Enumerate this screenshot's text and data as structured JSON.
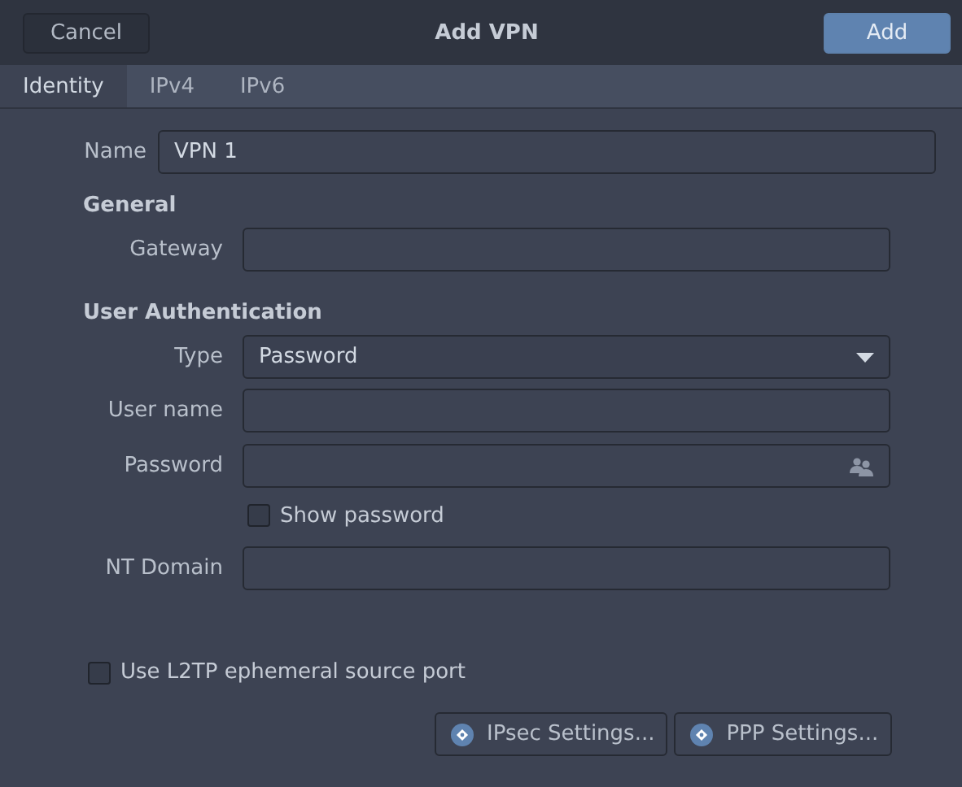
{
  "header": {
    "title": "Add VPN",
    "cancel": "Cancel",
    "add": "Add"
  },
  "tabs": [
    {
      "label": "Identity",
      "selected": true
    },
    {
      "label": "IPv4",
      "selected": false
    },
    {
      "label": "IPv6",
      "selected": false
    }
  ],
  "name": {
    "label": "Name",
    "value": "VPN 1"
  },
  "general": {
    "heading": "General",
    "gateway": {
      "label": "Gateway"
    }
  },
  "auth": {
    "heading": "User Authentication",
    "fields": [
      {
        "kind": "select",
        "label": "Type",
        "value": "Password"
      },
      {
        "kind": "text",
        "label": "User name"
      },
      {
        "kind": "password",
        "label": "Password"
      },
      {
        "kind": "checkbox",
        "label": "Show password",
        "checked": false
      },
      {
        "kind": "text",
        "label": "NT Domain"
      }
    ]
  },
  "ephemeral": {
    "label": "Use L2TP ephemeral source port",
    "checked": false
  },
  "buttons": [
    "IPsec Settings...",
    "PPP Settings..."
  ]
}
